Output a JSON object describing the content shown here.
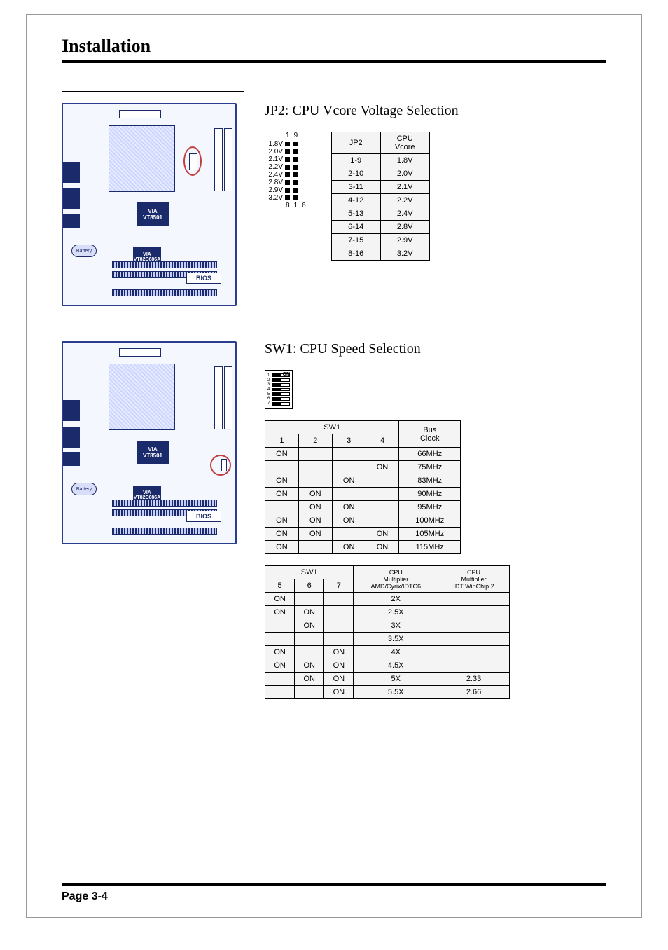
{
  "title": "Installation",
  "page_label": "Page 3-4",
  "board_labels": {
    "chip_main": "VIA\nVT8501",
    "chip_sub": "VIA\nVT82C686A",
    "bios": "BIOS",
    "battery": "Battery"
  },
  "jp2": {
    "heading": "JP2: CPU Vcore Voltage Selection",
    "diagram": {
      "top_left": "1",
      "top_right": "9",
      "bottom_left": "8",
      "bottom_right": "16",
      "rows": [
        "1.8V",
        "2.0V",
        "2.1V",
        "2.2V",
        "2.4V",
        "2.8V",
        "2.9V",
        "3.2V"
      ]
    },
    "table": {
      "headers": [
        "JP2",
        "CPU Vcore"
      ],
      "rows": [
        [
          "1-9",
          "1.8V"
        ],
        [
          "2-10",
          "2.0V"
        ],
        [
          "3-11",
          "2.1V"
        ],
        [
          "4-12",
          "2.2V"
        ],
        [
          "5-13",
          "2.4V"
        ],
        [
          "6-14",
          "2.8V"
        ],
        [
          "7-15",
          "2.9V"
        ],
        [
          "8-16",
          "3.2V"
        ]
      ]
    }
  },
  "sw1": {
    "heading": "SW1: CPU Speed Selection",
    "dip_numbers": [
      "1",
      "2",
      "3",
      "4",
      "5",
      "6",
      "7"
    ],
    "dip_on": "ON",
    "table_a": {
      "group_header": "SW1",
      "bus_header": "Bus\nClock",
      "cols": [
        "1",
        "2",
        "3",
        "4"
      ],
      "rows": [
        {
          "sw": [
            "ON",
            "",
            "",
            ""
          ],
          "clock": "66MHz"
        },
        {
          "sw": [
            "",
            "",
            "",
            "ON"
          ],
          "clock": "75MHz"
        },
        {
          "sw": [
            "ON",
            "",
            "ON",
            ""
          ],
          "clock": "83MHz"
        },
        {
          "sw": [
            "ON",
            "ON",
            "",
            ""
          ],
          "clock": "90MHz"
        },
        {
          "sw": [
            "",
            "ON",
            "ON",
            ""
          ],
          "clock": "95MHz"
        },
        {
          "sw": [
            "ON",
            "ON",
            "ON",
            ""
          ],
          "clock": "100MHz"
        },
        {
          "sw": [
            "ON",
            "ON",
            "",
            "ON"
          ],
          "clock": "105MHz"
        },
        {
          "sw": [
            "ON",
            "",
            "ON",
            "ON"
          ],
          "clock": "115MHz"
        }
      ]
    },
    "table_b": {
      "group_header": "SW1",
      "mult1_header": "CPU\nMultiplier\nAMD/Cyrix/IDTC6",
      "mult2_header": "CPU\nMultiplier\nIDT WinChip 2",
      "cols": [
        "5",
        "6",
        "7"
      ],
      "rows": [
        {
          "sw": [
            "ON",
            "",
            ""
          ],
          "m1": "2X",
          "m2": ""
        },
        {
          "sw": [
            "ON",
            "ON",
            ""
          ],
          "m1": "2.5X",
          "m2": ""
        },
        {
          "sw": [
            "",
            "ON",
            ""
          ],
          "m1": "3X",
          "m2": ""
        },
        {
          "sw": [
            "",
            "",
            ""
          ],
          "m1": "3.5X",
          "m2": ""
        },
        {
          "sw": [
            "ON",
            "",
            "ON"
          ],
          "m1": "4X",
          "m2": ""
        },
        {
          "sw": [
            "ON",
            "ON",
            "ON"
          ],
          "m1": "4.5X",
          "m2": ""
        },
        {
          "sw": [
            "",
            "ON",
            "ON"
          ],
          "m1": "5X",
          "m2": "2.33"
        },
        {
          "sw": [
            "",
            "",
            "ON"
          ],
          "m1": "5.5X",
          "m2": "2.66"
        }
      ]
    }
  }
}
